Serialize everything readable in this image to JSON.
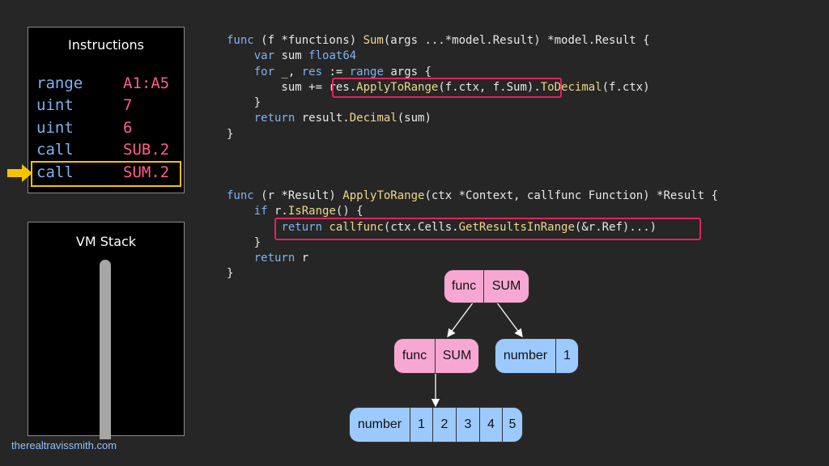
{
  "instructions_panel": {
    "title": "Instructions",
    "rows": [
      {
        "op": "range",
        "arg": "A1:A5"
      },
      {
        "op": "uint",
        "arg": "7"
      },
      {
        "op": "uint",
        "arg": "6"
      },
      {
        "op": "call",
        "arg": "SUB.2"
      },
      {
        "op": "call",
        "arg": "SUM.2"
      }
    ],
    "current_index": 4
  },
  "stack_panel": {
    "title": "VM Stack"
  },
  "code": {
    "block1": [
      "func (f *functions) Sum(args ...*model.Result) *model.Result {",
      "    var sum float64",
      "    for _, res := range args {",
      "        sum += res.ApplyToRange(f.ctx, f.Sum).ToDecimal(f.ctx)",
      "    }",
      "    return result.Decimal(sum)",
      "}"
    ],
    "block2": [
      "func (r *Result) ApplyToRange(ctx *Context, callfunc Function) *Result {",
      "    if r.IsRange() {",
      "        return callfunc(ctx.Cells.GetResultsInRange(&r.Ref)...)",
      "    }",
      "    return r",
      "}"
    ]
  },
  "tree": {
    "root": [
      "func",
      "SUM"
    ],
    "left": [
      "func",
      "SUM"
    ],
    "right": [
      "number",
      "1"
    ],
    "leaf": [
      "number",
      "1",
      "2",
      "3",
      "4",
      "5"
    ]
  },
  "credit": "therealtravissmith.com",
  "colors": {
    "keyword": "#7eb3f0",
    "function": "#f0d78c",
    "highlight": "#e0245e",
    "pointer": "#f5c400"
  }
}
